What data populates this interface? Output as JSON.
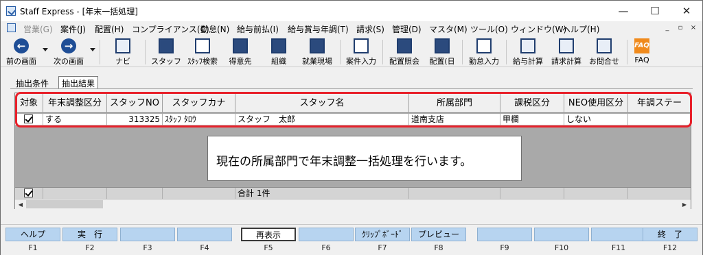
{
  "window": {
    "title": "Staff Express - [年末一括処理]",
    "controls": [
      "—",
      "☐",
      "✕"
    ]
  },
  "menu": {
    "items": [
      {
        "label": "営業(G)",
        "disabled": true
      },
      {
        "label": "案件(J)",
        "disabled": false
      },
      {
        "label": "配置(H)",
        "disabled": false
      },
      {
        "label": "コンプライアンス(C)",
        "disabled": false
      },
      {
        "label": "勤怠(N)",
        "disabled": false
      },
      {
        "label": "給与前払(I)",
        "disabled": false
      },
      {
        "label": "給与賞与年調(T)",
        "disabled": false
      },
      {
        "label": "請求(S)",
        "disabled": false
      },
      {
        "label": "管理(D)",
        "disabled": false
      },
      {
        "label": "マスタ(M)",
        "disabled": false
      },
      {
        "label": "ツール(O)",
        "disabled": false
      },
      {
        "label": "ウィンドウ(W)",
        "disabled": false
      },
      {
        "label": "ヘルプ(H)",
        "disabled": false
      }
    ],
    "mdi_controls": [
      "_",
      "▫",
      "×"
    ]
  },
  "toolbar": {
    "items": [
      {
        "label": "前の画面",
        "icon": "back-arrow-icon"
      },
      {
        "label": "次の画面",
        "icon": "forward-arrow-icon"
      },
      {
        "label": "ナビ",
        "icon": "keyboard-icon"
      },
      {
        "label": "スタッフ",
        "icon": "staff-icon"
      },
      {
        "label": "ｽﾀｯﾌ検索",
        "icon": "staff-search-icon"
      },
      {
        "label": "得意先",
        "icon": "client-icon"
      },
      {
        "label": "組織",
        "icon": "organization-icon"
      },
      {
        "label": "就業現場",
        "icon": "worksite-icon"
      },
      {
        "label": "案件入力",
        "icon": "case-entry-icon"
      },
      {
        "label": "配置照会",
        "icon": "assignment-query-icon"
      },
      {
        "label": "配置(日",
        "icon": "assignment-daily-icon"
      },
      {
        "label": "勤怠入力",
        "icon": "attendance-entry-icon"
      },
      {
        "label": "給与計算",
        "icon": "payroll-calc-icon"
      },
      {
        "label": "請求計算",
        "icon": "billing-calc-icon"
      },
      {
        "label": "お問合せ",
        "icon": "inquiry-icon"
      },
      {
        "label": "FAQ",
        "icon": "faq-icon"
      }
    ]
  },
  "tabs": {
    "condition": "抽出条件",
    "result": "抽出結果"
  },
  "grid": {
    "columns": [
      "対象",
      "年末調整区分",
      "スタッフNO",
      "スタッフカナ",
      "スタッフ名",
      "所属部門",
      "課税区分",
      "NEO使用区分",
      "年調ステー"
    ],
    "rows": [
      {
        "checked": true,
        "year_end": "する",
        "staff_no": "313325",
        "kana": "ｽﾀｯﾌ ﾀﾛｳ",
        "name": "スタッフ　太郎",
        "dept": "道南支店",
        "tax": "甲欄",
        "neo": "しない",
        "status": ""
      }
    ],
    "total_label": "合計 1件"
  },
  "message": "現在の所属部門で年末調整一括処理を行います。",
  "function_keys": [
    {
      "label": "ヘルプ",
      "key": "F1",
      "active": false
    },
    {
      "label": "実　行",
      "key": "F2",
      "active": false
    },
    {
      "label": "",
      "key": "F3",
      "active": false
    },
    {
      "label": "",
      "key": "F4",
      "active": false
    },
    {
      "label": "再表示",
      "key": "F5",
      "active": true
    },
    {
      "label": "",
      "key": "F6",
      "active": false
    },
    {
      "label": "ｸﾘｯﾌﾟﾎﾞｰﾄﾞ",
      "key": "F7",
      "active": false
    },
    {
      "label": "プレビュー",
      "key": "F8",
      "active": false
    },
    {
      "label": "",
      "key": "F9",
      "active": false
    },
    {
      "label": "",
      "key": "F10",
      "active": false
    },
    {
      "label": "",
      "key": "F11",
      "active": false
    },
    {
      "label": "終　了",
      "key": "F12",
      "active": false
    }
  ],
  "colors": {
    "fkey_bg": "#b7d4f0",
    "highlight": "#e8202a",
    "icon_blue": "#1f4e96",
    "faq_orange": "#f08a1c"
  }
}
